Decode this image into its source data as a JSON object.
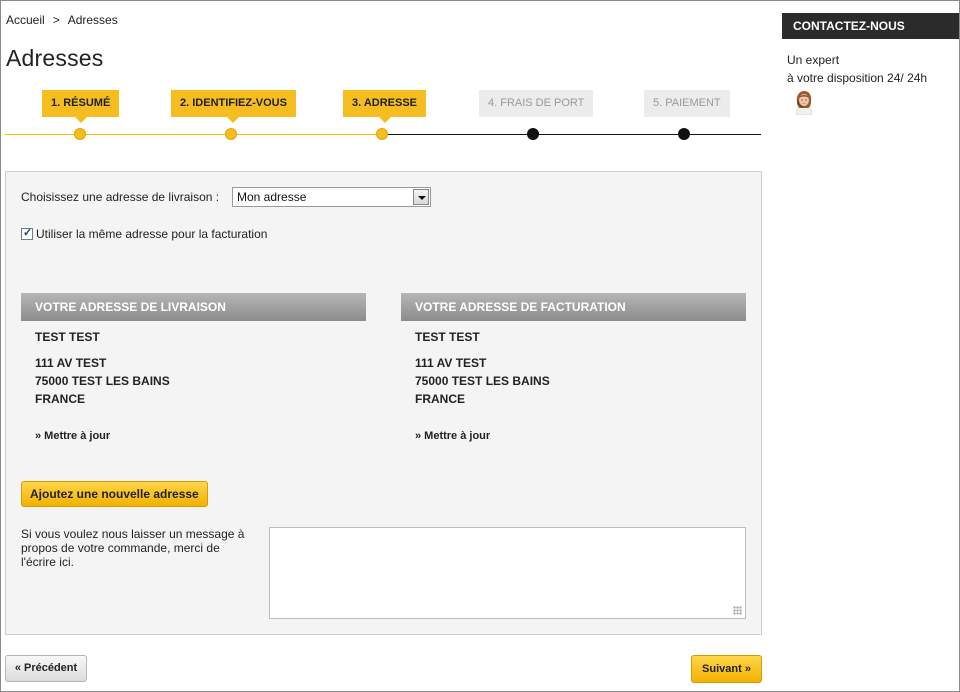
{
  "breadcrumb": {
    "home": "Accueil",
    "separator": ">",
    "current": "Adresses"
  },
  "page": {
    "title": "Adresses"
  },
  "steps": [
    {
      "label": "1. RÉSUMÉ",
      "state": "done"
    },
    {
      "label": "2. IDENTIFIEZ-VOUS",
      "state": "done"
    },
    {
      "label": "3. ADRESSE",
      "state": "current"
    },
    {
      "label": "4. FRAIS DE PORT",
      "state": "todo"
    },
    {
      "label": "5. PAIEMENT",
      "state": "todo"
    }
  ],
  "delivery": {
    "select_label": "Choisissez une adresse de livraison :",
    "selected_option": "Mon adresse",
    "same_address_label": "Utiliser la même adresse pour la facturation",
    "same_address_checked": true
  },
  "shipping_address": {
    "heading": "VOTRE ADRESSE DE LIVRAISON",
    "name": "TEST TEST",
    "street": "111 AV TEST",
    "city": "75000 TEST LES BAINS",
    "country": "FRANCE",
    "update_link": "» Mettre à jour"
  },
  "billing_address": {
    "heading": "VOTRE ADRESSE DE FACTURATION",
    "name": "TEST TEST",
    "street": "111 AV TEST",
    "city": "75000 TEST LES BAINS",
    "country": "FRANCE",
    "update_link": "» Mettre à jour"
  },
  "actions": {
    "add_address": "Ajoutez une nouvelle adresse",
    "previous": "« Précédent",
    "next": "Suivant »"
  },
  "message": {
    "label": "Si vous voulez nous laisser un message à propos de votre commande, merci de l'écrire ici.",
    "value": ""
  },
  "sidebar": {
    "heading": "CONTACTEZ-NOUS",
    "line1": "Un expert",
    "line2": "à votre disposition 24/ 24h"
  },
  "colors": {
    "accent": "#f5bd1f",
    "header_gray": "#9a9a9a",
    "dark": "#2b2b2b"
  }
}
